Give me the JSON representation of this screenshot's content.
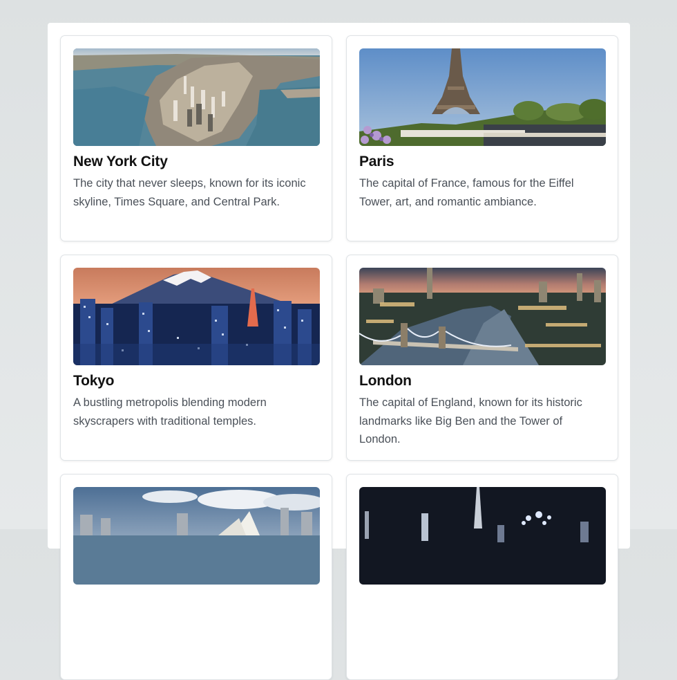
{
  "cities": [
    {
      "name": "New York City",
      "description": "The city that never sleeps, known for its iconic skyline, Times Square, and Central Park.",
      "image": "new-york-aerial-photo"
    },
    {
      "name": "Paris",
      "description": "The capital of France, famous for the Eiffel Tower, art, and romantic ambiance.",
      "image": "paris-eiffel-tower-photo"
    },
    {
      "name": "Tokyo",
      "description": "A bustling metropolis blending modern skyscrapers with traditional temples.",
      "image": "tokyo-mount-fuji-photo"
    },
    {
      "name": "London",
      "description": "The capital of England, known for its historic landmarks like Big Ben and the Tower of London.",
      "image": "london-tower-bridge-photo"
    },
    {
      "image": "sydney-opera-house-photo"
    },
    {
      "image": "dubai-night-skyline-photo"
    }
  ]
}
